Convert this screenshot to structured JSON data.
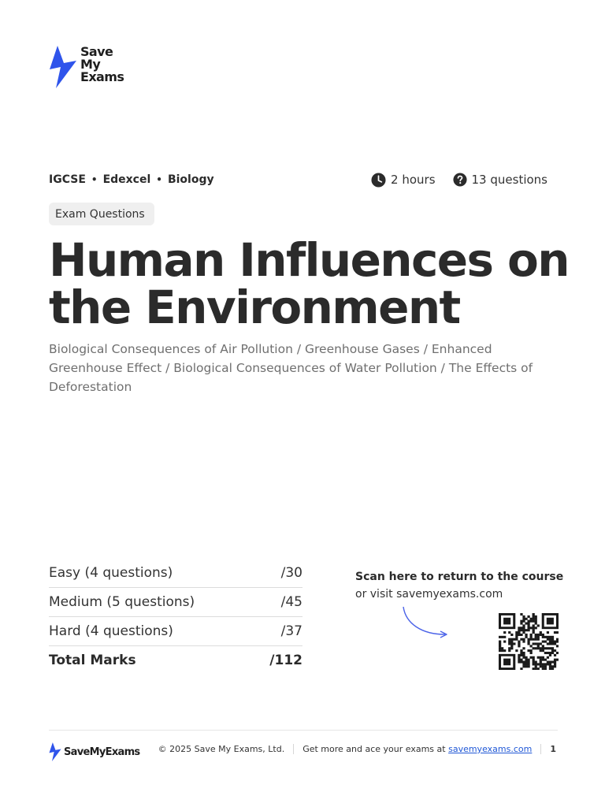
{
  "logo": {
    "line1": "Save",
    "line2": "My",
    "line3": "Exams",
    "footer_text": "SaveMyExams"
  },
  "breadcrumb": {
    "level": "IGCSE",
    "board": "Edexcel",
    "subject": "Biology",
    "separator": "•"
  },
  "stats": {
    "duration": "2 hours",
    "questions": "13 questions"
  },
  "tag": "Exam Questions",
  "title": "Human Influences on the Environment",
  "subtitle": "Biological Consequences of Air Pollution / Greenhouse Gases / Enhanced Greenhouse Effect / Biological Consequences of Water Pollution / The Effects of Deforestation",
  "marks": [
    {
      "label": "Easy (4 questions)",
      "value": "/30"
    },
    {
      "label": "Medium (5 questions)",
      "value": "/45"
    },
    {
      "label": "Hard (4 questions)",
      "value": "/37"
    }
  ],
  "total": {
    "label": "Total Marks",
    "value": "/112"
  },
  "scan": {
    "title": "Scan here to return to the course",
    "subtitle": "or visit savemyexams.com"
  },
  "footer": {
    "copyright": "© 2025 Save My Exams, Ltd.",
    "cta": "Get more and ace your exams at",
    "link": "savemyexams.com",
    "page": "1"
  },
  "colors": {
    "brand_blue": "#2f54eb",
    "text": "#2b2b2b",
    "muted": "#6f6f6f",
    "link": "#1f57d6"
  },
  "icons": {
    "logo": "lightning-bolt-icon",
    "duration": "clock-icon",
    "questions": "question-circle-icon",
    "qr": "qr-code-icon",
    "arrow": "curved-arrow-icon"
  }
}
